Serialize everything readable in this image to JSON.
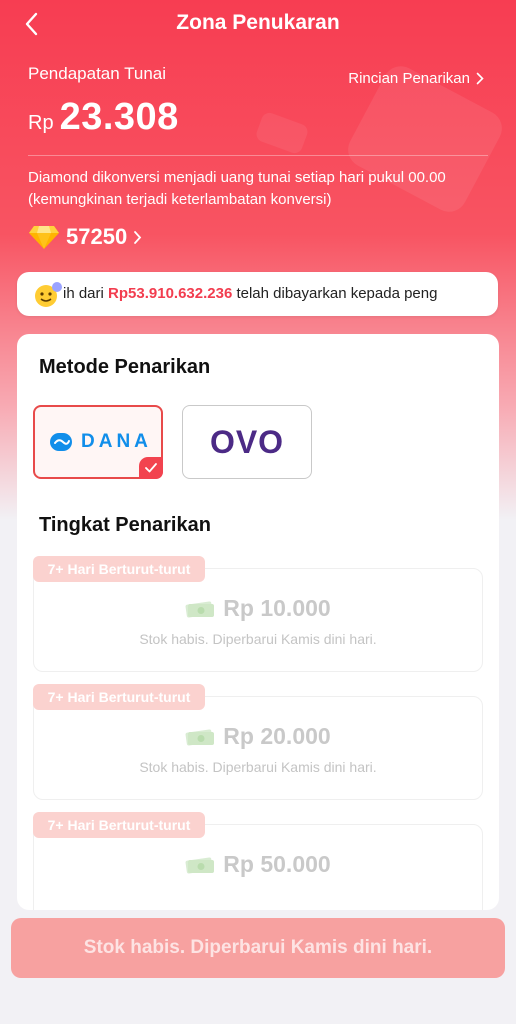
{
  "header": {
    "title": "Zona Penukaran",
    "back_icon": "chevron-left-icon"
  },
  "income": {
    "label": "Pendapatan Tunai",
    "currency": "Rp",
    "amount": "23.308",
    "details_link": "Rincian Penarikan"
  },
  "conversion_note": "Diamond dikonversi menjadi uang tunai setiap hari pukul 00.00 (kemungkinan terjadi keterlambatan konversi)",
  "diamonds": {
    "icon": "diamond-icon",
    "value": "57250"
  },
  "ticker": {
    "prefix": "ih dari ",
    "highlight": "Rp53.910.632.236",
    "suffix": " telah dibayarkan kepada peng"
  },
  "withdraw_method": {
    "title": "Metode Penarikan",
    "options": [
      {
        "label": "DANA",
        "selected": true
      },
      {
        "label": "OVO",
        "selected": false
      }
    ]
  },
  "withdraw_level": {
    "title": "Tingkat Penarikan",
    "tiers": [
      {
        "badge": "7+ Hari Berturut-turut",
        "amount": "Rp 10.000",
        "status": "Stok habis. Diperbarui Kamis dini hari."
      },
      {
        "badge": "7+ Hari Berturut-turut",
        "amount": "Rp 20.000",
        "status": "Stok habis. Diperbarui Kamis dini hari."
      },
      {
        "badge": "7+ Hari Berturut-turut",
        "amount": "Rp 50.000",
        "status": ""
      }
    ]
  },
  "bottom_button": "Stok habis. Diperbarui Kamis dini hari.",
  "colors": {
    "accent": "#f73d52",
    "highlight_text": "#f23d4f",
    "disabled_button": "#f7a1a0"
  }
}
